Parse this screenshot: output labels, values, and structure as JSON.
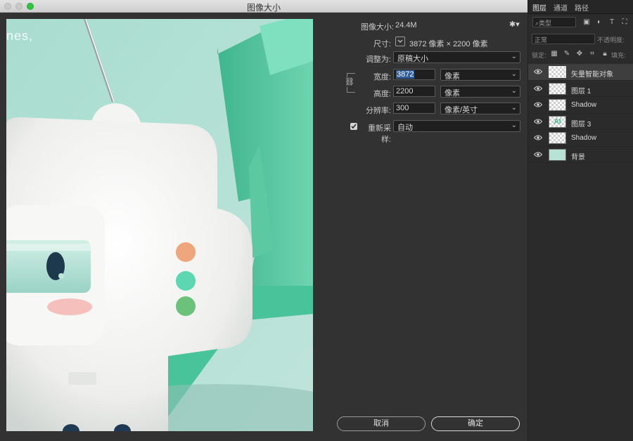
{
  "window": {
    "title": "图像大小",
    "colors": {
      "accent": "#2f5c9a",
      "panel_bg": "#323232",
      "mint": "#6fd3b0"
    }
  },
  "preview": {
    "overlay_text": "nes,"
  },
  "form": {
    "image_size_label": "图像大小:",
    "image_size_value": "24.4M",
    "dimensions_label": "尺寸:",
    "dimensions_value": "3872 像素 × 2200 像素",
    "fit_to_label": "调整为:",
    "fit_to_value": "原稿大小",
    "width_label": "宽度:",
    "width_value": "3872",
    "width_unit": "像素",
    "height_label": "高度:",
    "height_value": "2200",
    "height_unit": "像素",
    "resolution_label": "分辨率:",
    "resolution_value": "300",
    "resolution_unit": "像素/英寸",
    "resample_label": "重新采样:",
    "resample_checked": true,
    "resample_value": "自动",
    "cancel_label": "取消",
    "ok_label": "确定"
  },
  "panel": {
    "tabs": [
      "图层",
      "通道",
      "路径"
    ],
    "filter_placeholder": "类型",
    "blend_mode": "正常",
    "opacity_label": "不透明度:",
    "lock_label": "锁定:",
    "fill_label": "填充:",
    "layers": [
      {
        "name": "矢量智能对象",
        "thumb": "checker",
        "selected": true
      },
      {
        "name": "图层 1",
        "thumb": "checker",
        "selected": false
      },
      {
        "name": "Shadow",
        "thumb": "checker",
        "selected": false
      },
      {
        "name": "图层 3",
        "thumb": "ai",
        "selected": false
      },
      {
        "name": "Shadow",
        "thumb": "checker",
        "selected": false
      },
      {
        "name": "背景",
        "thumb": "mint",
        "selected": false
      }
    ]
  }
}
